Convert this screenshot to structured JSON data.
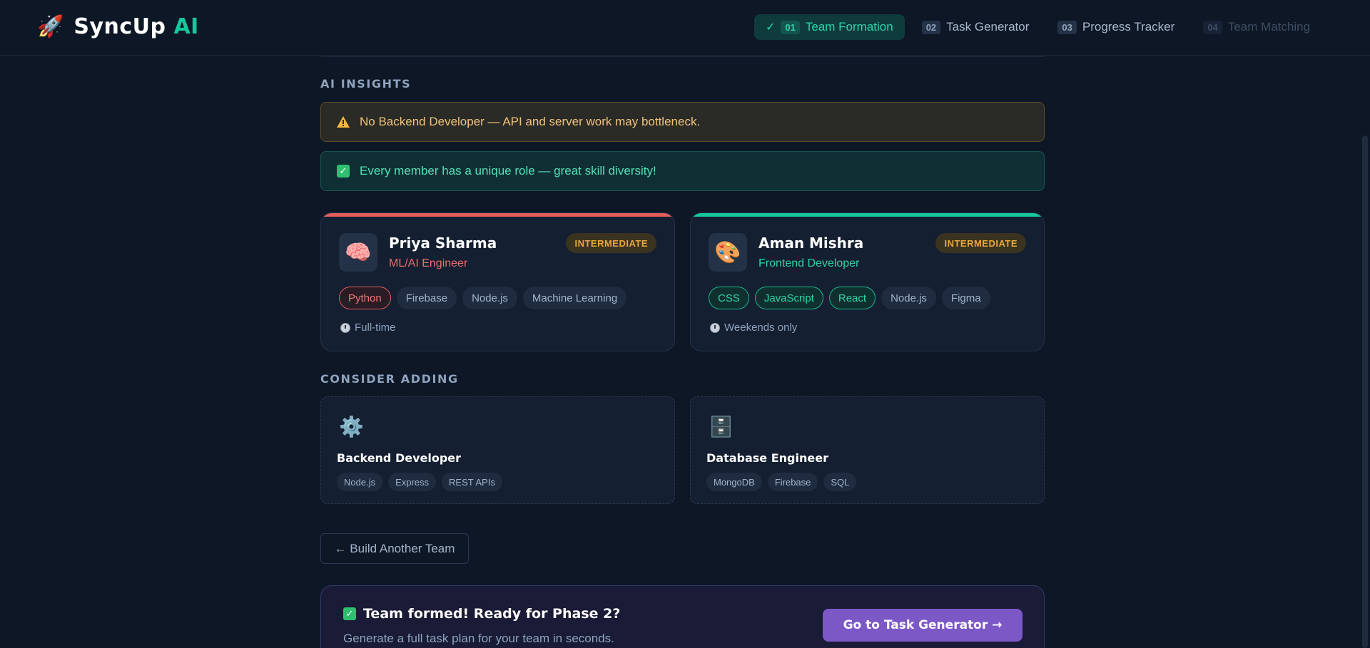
{
  "app": {
    "logo_emoji": "🚀",
    "name": "SyncUp",
    "name_accent": "AI"
  },
  "steps": [
    {
      "check": "✓",
      "num": "01",
      "label": "Team Formation",
      "state": "active"
    },
    {
      "num": "02",
      "label": "Task Generator",
      "state": "normal"
    },
    {
      "num": "03",
      "label": "Progress Tracker",
      "state": "normal"
    },
    {
      "num": "04",
      "label": "Team Matching",
      "state": "disabled"
    }
  ],
  "insights": {
    "title": "AI INSIGHTS",
    "warning": "No Backend Developer — API and server work may bottleneck.",
    "success_icon": "✓",
    "success": "Every member has a unique role — great skill diversity!"
  },
  "members": [
    {
      "avatar": "🧠",
      "name": "Priya Sharma",
      "role": "ML/AI Engineer",
      "role_color": "#ef6b6b",
      "accent": "#e35d5d",
      "level": "INTERMEDIATE",
      "skills": [
        {
          "label": "Python",
          "highlight": "red"
        },
        {
          "label": "Firebase",
          "highlight": ""
        },
        {
          "label": "Node.js",
          "highlight": ""
        },
        {
          "label": "Machine Learning",
          "highlight": ""
        }
      ],
      "availability": "Full-time"
    },
    {
      "avatar": "🎨",
      "name": "Aman Mishra",
      "role": "Frontend Developer",
      "role_color": "#2fd3a8",
      "accent": "#16c79a",
      "level": "INTERMEDIATE",
      "skills": [
        {
          "label": "CSS",
          "highlight": "green"
        },
        {
          "label": "JavaScript",
          "highlight": "green"
        },
        {
          "label": "React",
          "highlight": "green"
        },
        {
          "label": "Node.js",
          "highlight": ""
        },
        {
          "label": "Figma",
          "highlight": ""
        }
      ],
      "availability": "Weekends only"
    }
  ],
  "consider": {
    "title": "CONSIDER ADDING",
    "items": [
      {
        "icon": "⚙️",
        "title": "Backend Developer",
        "tags": [
          "Node.js",
          "Express",
          "REST APIs"
        ]
      },
      {
        "icon": "🗄️",
        "title": "Database Engineer",
        "tags": [
          "MongoDB",
          "Firebase",
          "SQL"
        ]
      }
    ]
  },
  "build_another": "← Build Another Team",
  "cta": {
    "icon": "✓",
    "title": "Team formed! Ready for Phase 2?",
    "subtitle": "Generate a full task plan for your team in seconds.",
    "button": "Go to Task Generator →"
  }
}
